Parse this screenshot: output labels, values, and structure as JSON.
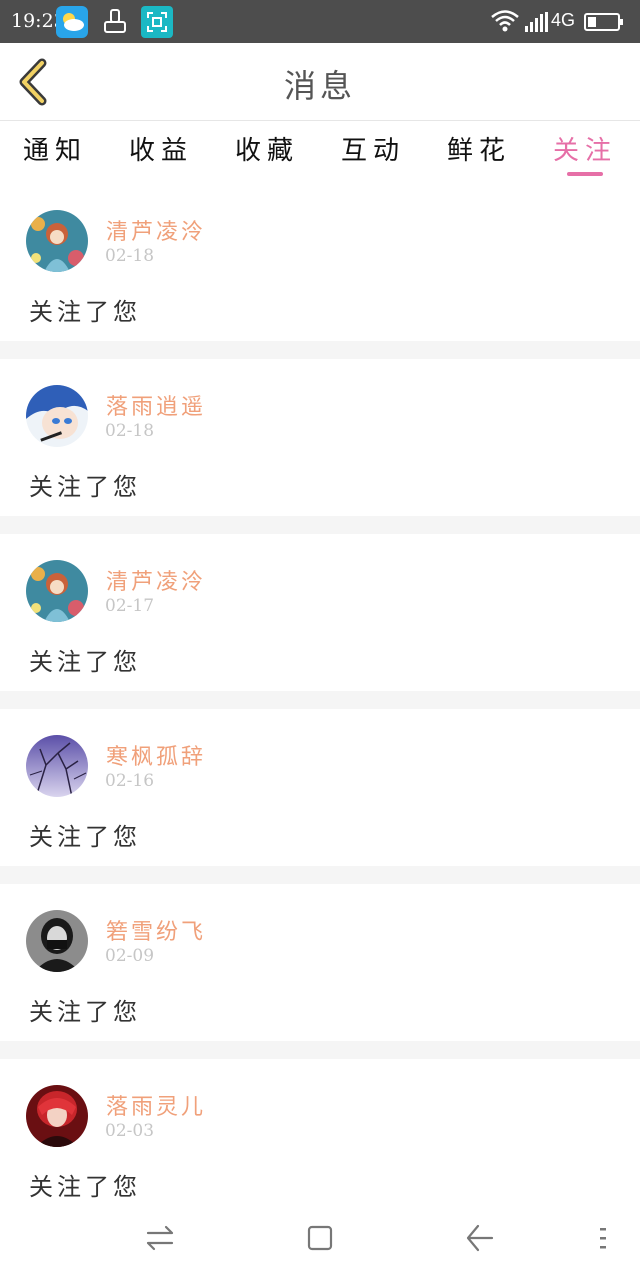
{
  "status_bar": {
    "time": "19:23",
    "network": "4G",
    "icons": [
      "weather-icon",
      "clean-icon",
      "scan-icon",
      "wifi-icon",
      "signal-icon",
      "battery-icon"
    ]
  },
  "header": {
    "title": "消息",
    "back_icon": "chevron-left-icon"
  },
  "tabs": [
    {
      "label": "通知",
      "active": false
    },
    {
      "label": "收益",
      "active": false
    },
    {
      "label": "收藏",
      "active": false
    },
    {
      "label": "互动",
      "active": false
    },
    {
      "label": "鲜花",
      "active": false
    },
    {
      "label": "关注",
      "active": true
    }
  ],
  "notifications": [
    {
      "username": "清芦凌泠",
      "date": "02-18",
      "message": "关注了您"
    },
    {
      "username": "落雨逍遥",
      "date": "02-18",
      "message": "关注了您"
    },
    {
      "username": "清芦凌泠",
      "date": "02-17",
      "message": "关注了您"
    },
    {
      "username": "寒枫孤辞",
      "date": "02-16",
      "message": "关注了您"
    },
    {
      "username": "箬雪纷飞",
      "date": "02-09",
      "message": "关注了您"
    },
    {
      "username": "落雨灵儿",
      "date": "02-03",
      "message": "关注了您"
    }
  ],
  "nav_bar": {
    "icons": [
      "switch-icon",
      "home-icon",
      "back-icon",
      "menu-icon"
    ]
  },
  "colors": {
    "accent": "#e66fa7",
    "username": "#f0a07a",
    "date": "#c6c6c6",
    "status_bar": "#4d4d4d",
    "separator": "#f5f5f5"
  }
}
